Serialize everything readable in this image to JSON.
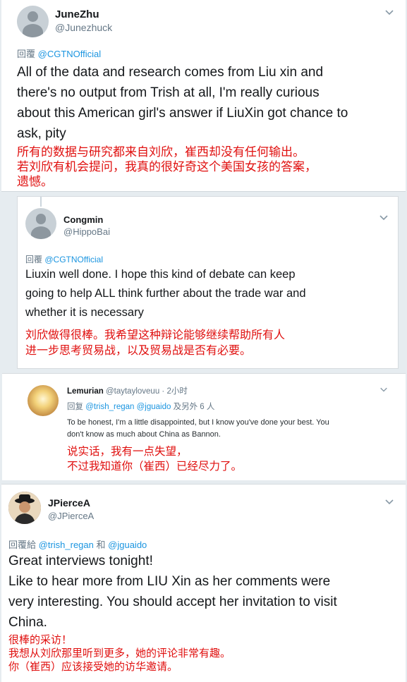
{
  "tweet1": {
    "name": "JuneZhu",
    "handle": "@Junezhuck",
    "reply_prefix": "回覆",
    "reply_mention": "@CGTNOfficial",
    "text_lines": [
      "All of the data and research comes from Liu xin and",
      "there's no output from Trish at all, I'm really curious",
      "about this American girl's answer if LiuXin got chance to",
      "ask, pity"
    ],
    "cn_lines": [
      "所有的数据与研究都来自刘欣，崔西却没有任何输出。",
      "若刘欣有机会提问，我真的很好奇这个美国女孩的答案，",
      "遗憾。"
    ]
  },
  "tweet2": {
    "name": "Congmin",
    "handle": "@HippoBai",
    "reply_prefix": "回覆",
    "reply_mention": "@CGTNOfficial",
    "text_lines": [
      "Liuxin well done. I hope this kind of debate can keep",
      "going to help ALL think further about the trade war and",
      "whether it is necessary"
    ],
    "cn_lines": [
      "刘欣做得很棒。我希望这种辩论能够继续帮助所有人",
      "进一步思考贸易战，以及贸易战是否有必要。"
    ]
  },
  "tweet3": {
    "name": "Lemurian",
    "handle": "@taytayloveuu",
    "time": "· 2小时",
    "reply_prefix": "回复",
    "reply_mention1": "@trish_regan",
    "reply_mention2": "@jguaido",
    "reply_suffix": "及另外 6 人",
    "text_lines": [
      "To be honest, I'm a little disappointed, but I know you've done your best. You",
      "don't know as much about China as Bannon."
    ],
    "cn_lines": [
      "说实话，我有一点失望，",
      "不过我知道你（崔西）已经尽力了。"
    ]
  },
  "tweet4": {
    "name": "JPierceA",
    "handle": "@JPierceA",
    "reply_prefix": "回覆給",
    "reply_mention1": "@trish_regan",
    "reply_and": "和",
    "reply_mention2": "@jguaido",
    "text_lines": [
      "Great interviews tonight!",
      "Like to hear more from LIU Xin as her comments were",
      "very interesting.  You should accept her invitation to visit",
      "China."
    ],
    "cn_lines": [
      "很棒的采访！",
      "我想从刘欣那里听到更多，她的评论非常有趣。",
      "你（崔西）应该接受她的访华邀请。"
    ]
  },
  "icons": {
    "chevron": "chevron-down-icon",
    "avatar_default": "default-avatar-icon"
  },
  "colors": {
    "link": "#1b95e0",
    "secondary": "#657786",
    "translation": "#e0100f"
  }
}
